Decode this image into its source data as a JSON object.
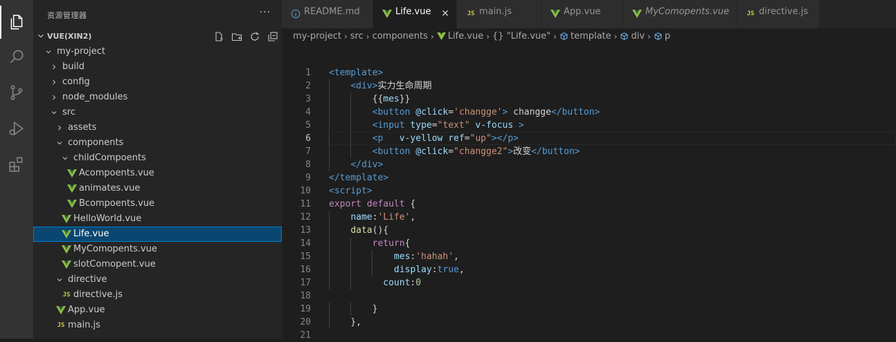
{
  "activity_bar": {
    "items": [
      {
        "name": "explorer",
        "icon": "files-icon"
      },
      {
        "name": "search",
        "icon": "search-icon"
      },
      {
        "name": "source-control",
        "icon": "source-control-icon"
      },
      {
        "name": "run-debug",
        "icon": "run-debug-icon"
      },
      {
        "name": "extensions",
        "icon": "extensions-icon"
      }
    ]
  },
  "sidebar": {
    "title": "资源管理器",
    "more": "···",
    "section_label": "VUE(XIN2)",
    "actions": [
      "new-file-icon",
      "new-folder-icon",
      "refresh-icon",
      "collapse-all-icon"
    ],
    "tree": [
      {
        "label": "my-project",
        "type": "folder",
        "open": true
      },
      {
        "label": "build",
        "type": "folder",
        "open": false
      },
      {
        "label": "config",
        "type": "folder",
        "open": false
      },
      {
        "label": "node_modules",
        "type": "folder",
        "open": false
      },
      {
        "label": "src",
        "type": "folder",
        "open": true
      },
      {
        "label": "assets",
        "type": "folder",
        "open": false
      },
      {
        "label": "components",
        "type": "folder",
        "open": true
      },
      {
        "label": "childCompoents",
        "type": "folder",
        "open": true
      },
      {
        "label": "Acompoents.vue",
        "type": "vue"
      },
      {
        "label": "animates.vue",
        "type": "vue"
      },
      {
        "label": "Bcompoents.vue",
        "type": "vue"
      },
      {
        "label": "HelloWorld.vue",
        "type": "vue"
      },
      {
        "label": "Life.vue",
        "type": "vue",
        "selected": true
      },
      {
        "label": "MyComopents.vue",
        "type": "vue"
      },
      {
        "label": "slotComopent.vue",
        "type": "vue"
      },
      {
        "label": "directive",
        "type": "folder",
        "open": true
      },
      {
        "label": "directive.js",
        "type": "js"
      },
      {
        "label": "App.vue",
        "type": "vue"
      },
      {
        "label": "main.js",
        "type": "js"
      }
    ]
  },
  "tabs": [
    {
      "label": "README.md",
      "icon": "info-icon",
      "active": false
    },
    {
      "label": "Life.vue",
      "icon": "vue-icon",
      "active": true,
      "close": "✕"
    },
    {
      "label": "main.js",
      "icon": "js-icon",
      "active": false
    },
    {
      "label": "App.vue",
      "icon": "vue-icon",
      "active": false
    },
    {
      "label": "MyComopents.vue",
      "icon": "vue-icon",
      "active": false,
      "italic": true
    },
    {
      "label": "directive.js",
      "icon": "js-icon",
      "active": false
    }
  ],
  "breadcrumb": [
    {
      "label": "my-project"
    },
    {
      "label": "src"
    },
    {
      "label": "components"
    },
    {
      "label": "Life.vue",
      "icon": "vue-icon"
    },
    {
      "label": "{} \"Life.vue\""
    },
    {
      "label": "template",
      "icon": "cube-icon"
    },
    {
      "label": "div",
      "icon": "cube-icon"
    },
    {
      "label": "p",
      "icon": "cube-icon"
    }
  ],
  "editor": {
    "current_line": 6,
    "lines": [
      {
        "n": "1",
        "text": "<template>"
      },
      {
        "n": "2",
        "text": "    <div>实力生命周期"
      },
      {
        "n": "3",
        "text": "        {{mes}}"
      },
      {
        "n": "4",
        "text": "        <button @click='changge'> changge</button>"
      },
      {
        "n": "5",
        "text": "        <input type=\"text\" v-focus >"
      },
      {
        "n": "6",
        "text": "        <p   v-yellow ref=\"up\"></p>"
      },
      {
        "n": "7",
        "text": "        <button @click=\"changge2\">改变</button>"
      },
      {
        "n": "8",
        "text": "    </div>"
      },
      {
        "n": "9",
        "text": "</template>"
      },
      {
        "n": "10",
        "text": "<script>"
      },
      {
        "n": "11",
        "text": "export default {"
      },
      {
        "n": "12",
        "text": "    name:'Life',"
      },
      {
        "n": "13",
        "text": "    data(){"
      },
      {
        "n": "14",
        "text": "        return{"
      },
      {
        "n": "15",
        "text": "            mes:'hahah',"
      },
      {
        "n": "16",
        "text": "            display:true,"
      },
      {
        "n": "17",
        "text": "          count:0"
      },
      {
        "n": "18",
        "text": ""
      },
      {
        "n": "19",
        "text": "        }"
      },
      {
        "n": "20",
        "text": "    },"
      },
      {
        "n": "21",
        "text": ""
      }
    ]
  },
  "colors": {
    "vue": "#8dc149",
    "js": "#cbcb41",
    "accent": "#007fd4",
    "selection": "#094771"
  }
}
